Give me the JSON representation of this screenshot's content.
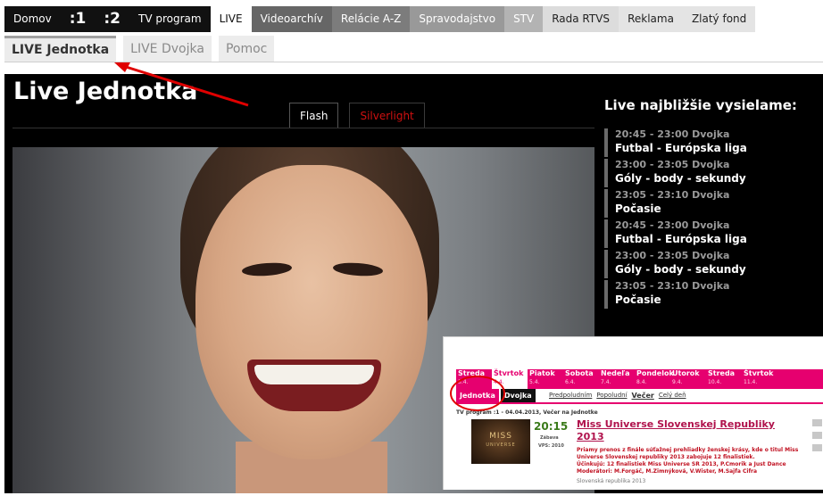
{
  "topnav": {
    "items": [
      "Domov",
      ":1",
      ":2",
      "TV program",
      "LIVE",
      "Videoarchív",
      "Relácie A-Z",
      "Spravodajstvo",
      "STV",
      "Rada RTVS",
      "Reklama",
      "Zlatý fond"
    ]
  },
  "subnav": {
    "tabs": [
      "LIVE Jednotka",
      "LIVE Dvojka",
      "Pomoc"
    ]
  },
  "main": {
    "title": "Live Jednotka",
    "player_tabs": [
      "Flash",
      "Silverlight"
    ]
  },
  "schedule": {
    "title": "Live najbližšie vysielame:",
    "entries": [
      {
        "time": "20:45 - 23:00 Dvojka",
        "show": "Futbal - Európska liga"
      },
      {
        "time": "23:00 - 23:05 Dvojka",
        "show": "Góly - body - sekundy"
      },
      {
        "time": "23:05 - 23:10 Dvojka",
        "show": "Počasie"
      },
      {
        "time": "20:45 - 23:00 Dvojka",
        "show": "Futbal - Európska liga"
      },
      {
        "time": "23:00 - 23:05 Dvojka",
        "show": "Góly - body - sekundy"
      },
      {
        "time": "23:05 - 23:10 Dvojka",
        "show": "Počasie"
      }
    ]
  },
  "inset": {
    "days": [
      {
        "name": "Streda",
        "date": "3.4."
      },
      {
        "name": "Štvrtok",
        "date": "4.4."
      },
      {
        "name": "Piatok",
        "date": "5.4."
      },
      {
        "name": "Sobota",
        "date": "6.4."
      },
      {
        "name": "Nedeľa",
        "date": "7.4."
      },
      {
        "name": "Pondelok",
        "date": "8.4."
      },
      {
        "name": "Utorok",
        "date": "9.4."
      },
      {
        "name": "Streda",
        "date": "10.4."
      },
      {
        "name": "Štvrtok",
        "date": "11.4."
      }
    ],
    "channels": [
      "Jednotka",
      "Dvojka"
    ],
    "dayparts": [
      "Predpoludním",
      "Popoludní",
      "Večer",
      "Celý deň"
    ],
    "crumb": "TV program :1 - 04.04.2013, Večer na Jednotke",
    "event": {
      "thumb_title": "MISS",
      "thumb_subtitle": "UNIVERSE",
      "time": "20:15",
      "genre": "Zábava",
      "rating": "VPS: 2010",
      "title": "Miss Universe Slovenskej Republiky 2013",
      "desc1": "Priamy prenos z finále súťažnej prehliadky ženskej krásy, kde o titul Miss Universe Slovenskej republiky 2013 zabojuje 12 finalistiek.",
      "desc2": "Účinkujú: 12 finalistiek Miss Universe SR 2013, P.Cmorik a Just Dance",
      "desc3": "Moderátori: M.Forgáč, M.Zimnýková, V.Wister, M.Sajfa Cifra",
      "origin": "Slovenská republika 2013"
    }
  },
  "colors": {
    "panel": "#000000",
    "accent": "#e6006f",
    "annotation": "#e00000"
  }
}
